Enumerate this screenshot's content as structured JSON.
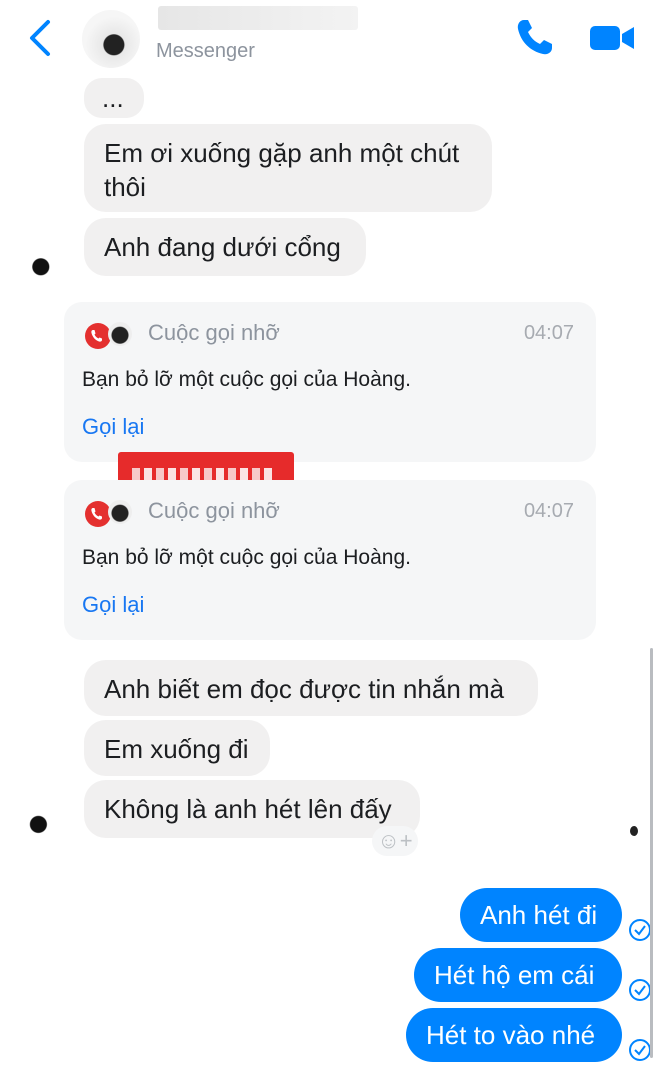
{
  "header": {
    "contact_name": "",
    "subtitle": "Messenger",
    "icons": {
      "back": "chevron-left-icon",
      "call": "phone-icon",
      "video": "video-camera-icon"
    },
    "accent_color": "#0084ff"
  },
  "messages_top": {
    "typing": "...",
    "msg1": "Em ơi xuống gặp anh một chút thôi",
    "msg2": "Anh đang dưới cổng"
  },
  "missed_calls": [
    {
      "title": "Cuộc gọi nhỡ",
      "time": "04:07",
      "body": "Bạn bỏ lỡ một cuộc gọi của Hoàng.",
      "action": "Gọi lại"
    },
    {
      "title": "Cuộc gọi nhỡ",
      "time": "04:07",
      "body": "Bạn bỏ lỡ một cuộc gọi của Hoàng.",
      "action": "Gọi lại"
    }
  ],
  "messages_mid": {
    "msg3": "Anh biết em đọc được tin nhắn mà",
    "msg4": "Em xuống đi",
    "msg5": "Không là anh hét lên đấy",
    "react_label": "☺+"
  },
  "messages_out": [
    {
      "text": "Anh hét đi",
      "status_icon": "seen-check-icon"
    },
    {
      "text": "Hét hộ em cái",
      "status_icon": "seen-check-icon"
    },
    {
      "text": "Hét to vào nhé",
      "status_icon": "seen-check-icon"
    }
  ],
  "colors": {
    "incoming_bubble": "#f1f0f0",
    "outgoing_bubble": "#0084ff",
    "missed_call_red": "#e4302f",
    "link_blue": "#1877f2"
  }
}
